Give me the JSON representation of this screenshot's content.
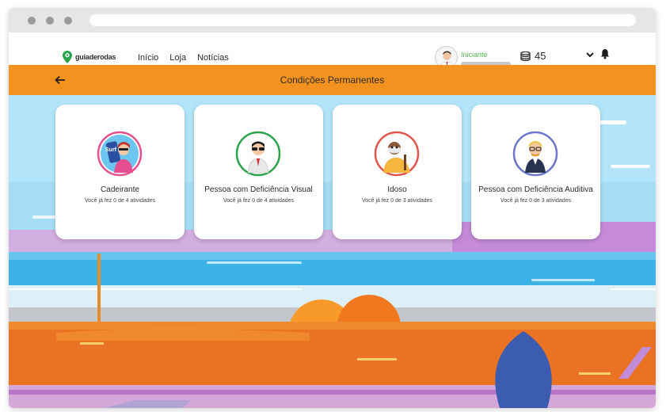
{
  "brand": {
    "name": "guiaderodas",
    "color": "#2aa44a"
  },
  "nav": {
    "links": [
      "Início",
      "Loja",
      "Notícias"
    ]
  },
  "user": {
    "level": "Iniciante",
    "coins": "45"
  },
  "header": {
    "title": "Condições Permanentes",
    "color": "#f4921f"
  },
  "cards": [
    {
      "title": "Cadeirante",
      "progress": "Você já fez 0 de 4 atividades",
      "ring": "#e64f8f",
      "icon": "wheelchair-user-avatar-icon"
    },
    {
      "title": "Pessoa com Deficiência Visual",
      "progress": "Você já fez 0 de 4 atividades",
      "ring": "#2aa44a",
      "icon": "visually-impaired-avatar-icon"
    },
    {
      "title": "Idoso",
      "progress": "Você já fez 0 de 3 atividades",
      "ring": "#e2554d",
      "icon": "elderly-avatar-icon"
    },
    {
      "title": "Pessoa com Deficiência Auditiva",
      "progress": "Você já fez 0 de 3 atividades",
      "ring": "#6d76c9",
      "icon": "hearing-impaired-avatar-icon"
    }
  ]
}
